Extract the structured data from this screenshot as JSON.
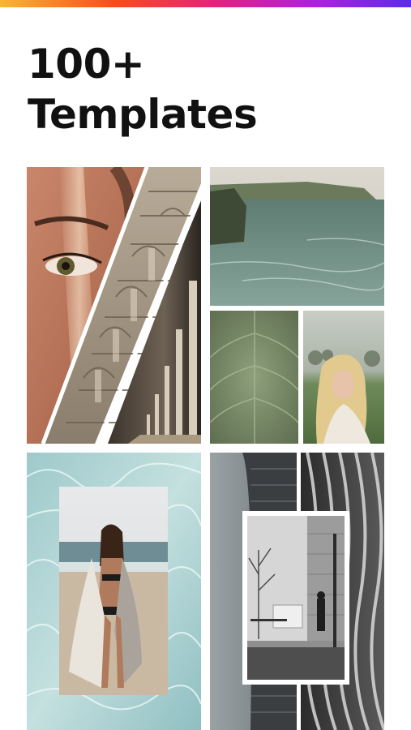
{
  "headline": {
    "line1": "100+",
    "line2": "Templates"
  },
  "colors": {
    "gradient": [
      "#f7b733",
      "#fc4a1a",
      "#e8207a",
      "#b020e0",
      "#5b2be8"
    ],
    "headline_text": "#111111",
    "background": "#ffffff"
  },
  "templates": [
    {
      "name": "diagonal-split-collage",
      "photos": [
        "woman-eye-portrait",
        "ornate-cathedral-arches",
        "colonnade-corridor"
      ]
    },
    {
      "name": "grid-collage",
      "photos": [
        "sea-cliff-coast",
        "green-leaf-macro",
        "blonde-woman-field"
      ]
    },
    {
      "name": "framed-overlay-collage",
      "photos": [
        "water-ripples-background",
        "beach-woman-towel"
      ]
    },
    {
      "name": "architecture-bw-collage",
      "photos": [
        "curved-building-facade",
        "wavy-building-facade",
        "street-scene-bw"
      ]
    }
  ]
}
